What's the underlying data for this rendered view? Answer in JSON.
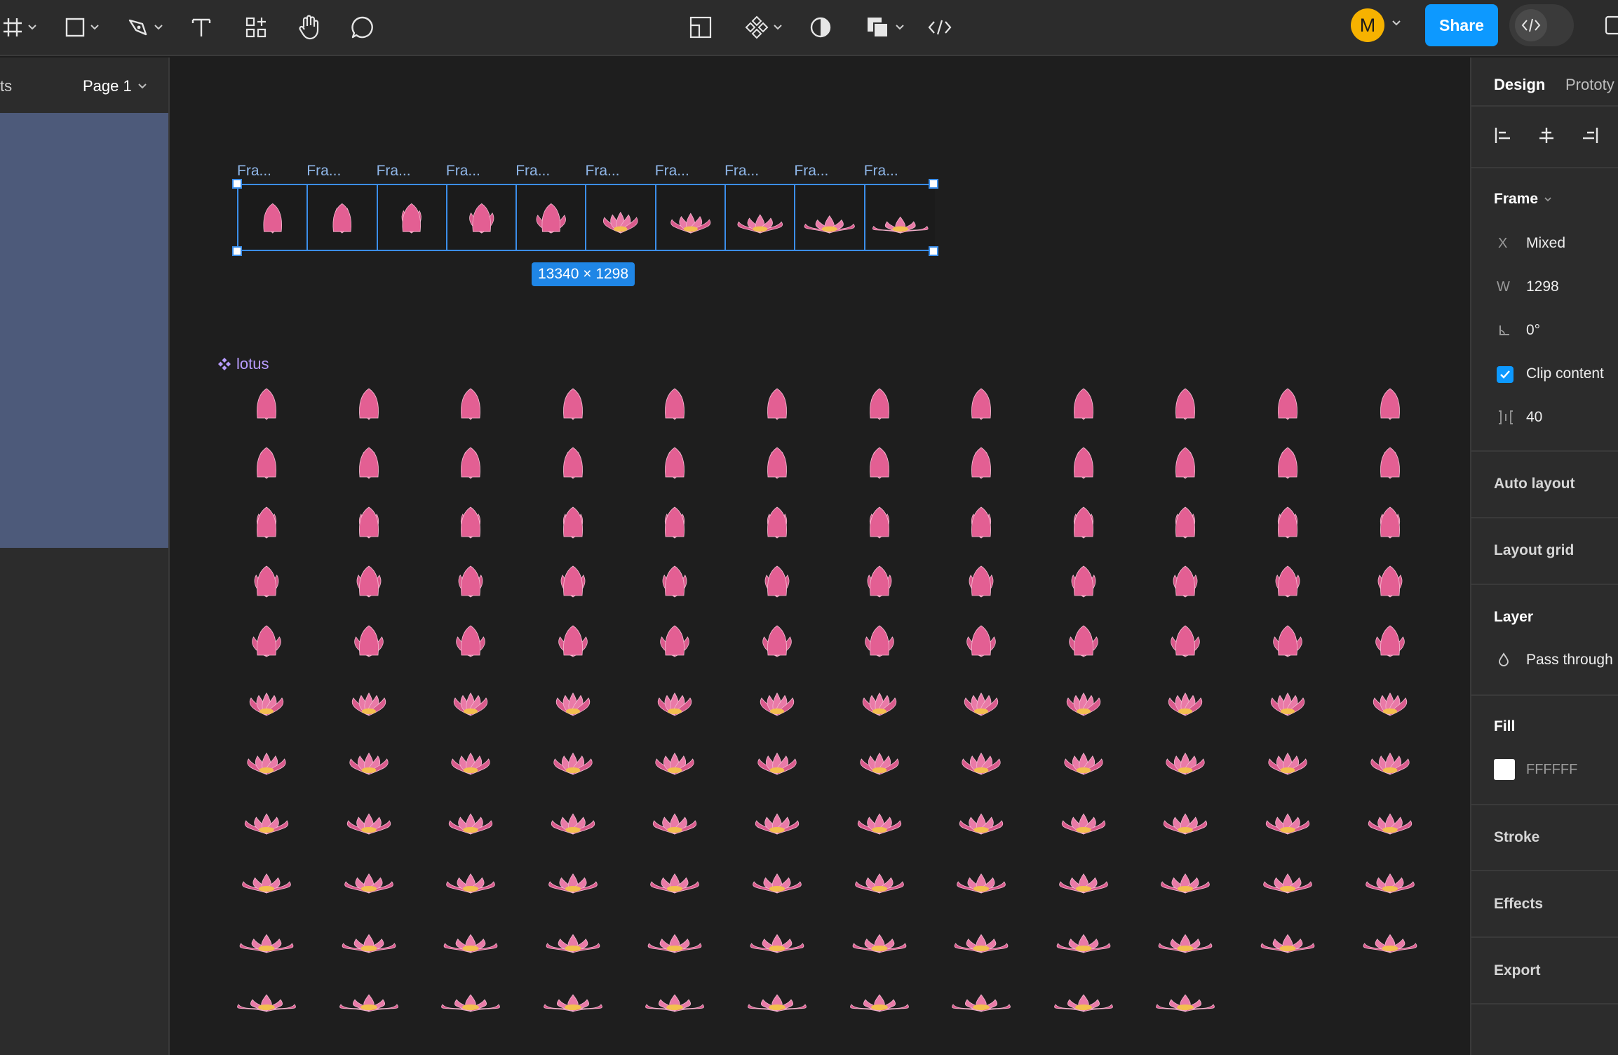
{
  "toolbar": {
    "share_label": "Share",
    "avatar_initial": "M",
    "colors": {
      "share_bg": "#0d99ff",
      "avatar_bg": "#f6b200"
    }
  },
  "left_panel": {
    "tab_label": "ts",
    "page_label": "Page 1"
  },
  "canvas": {
    "frame_labels": [
      "Fra...",
      "Fra...",
      "Fra...",
      "Fra...",
      "Fra...",
      "Fra...",
      "Fra...",
      "Fra...",
      "Fra...",
      "Fra..."
    ],
    "selection_size": "13340 × 1298",
    "component_name": "lotus",
    "lotus_grid": {
      "columns": 12,
      "full_rows": 10,
      "last_row_count": 10
    }
  },
  "design_panel": {
    "tabs": [
      "Design",
      "Prototy"
    ],
    "frame_section": "Frame",
    "x_label": "X",
    "x_value": "Mixed",
    "w_label": "W",
    "w_value": "1298",
    "rotation_value": "0°",
    "clip_content_label": "Clip content",
    "spacing_value": "40",
    "auto_layout": "Auto layout",
    "layout_grid": "Layout grid",
    "layer_section": "Layer",
    "blend_mode": "Pass through",
    "fill_section": "Fill",
    "fill_hex": "FFFFFF",
    "stroke_section": "Stroke",
    "effects_section": "Effects",
    "export_section": "Export"
  }
}
